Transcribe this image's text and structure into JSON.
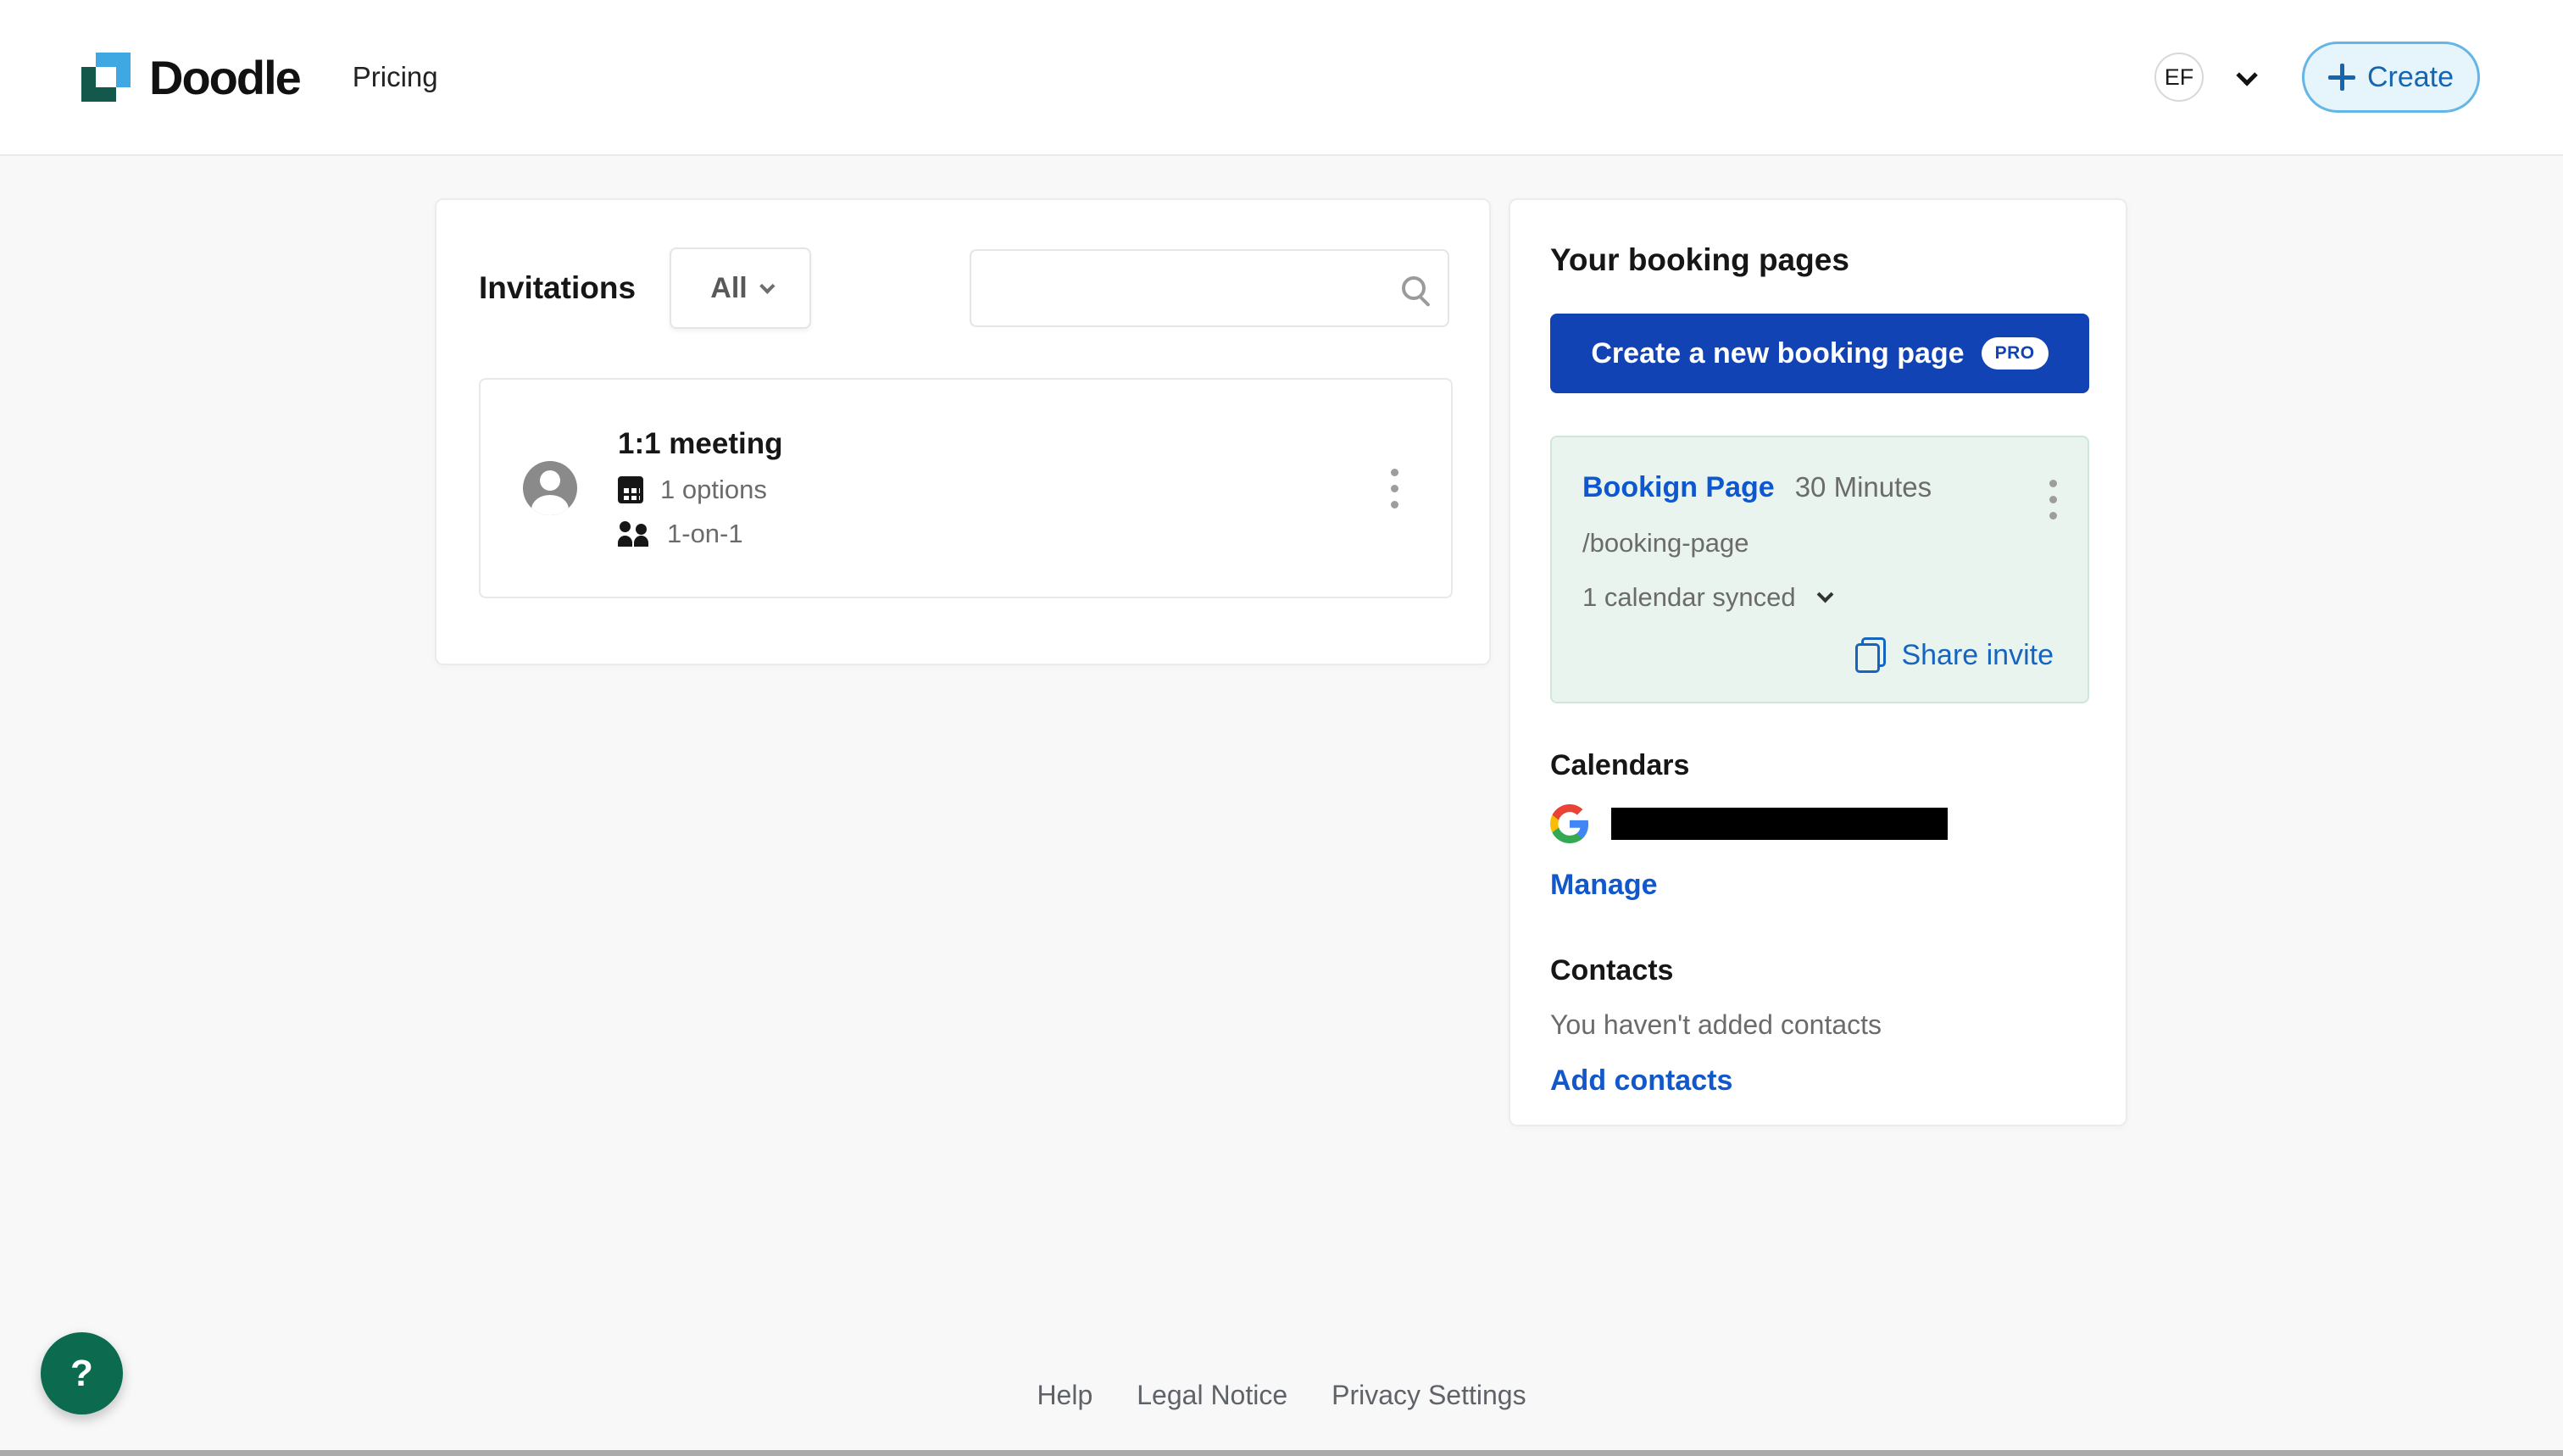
{
  "colors": {
    "primary_button_blue": "#1243B5",
    "link_blue": "#1258CB",
    "booking_name_blue": "#0D57D1",
    "share_link_blue": "#1565C0",
    "booking_card_bg": "#E8F4ED",
    "booking_card_border": "#CFE7D8",
    "create_pill_bg": "#E6F4FC",
    "create_pill_border": "#63B6E6",
    "create_pill_text": "#1566B0",
    "fab_green": "#0C6B4F",
    "logo_blue": "#3FA8E2",
    "logo_green": "#14584C",
    "page_bg": "#F8F8F8"
  },
  "header": {
    "brand": "Doodle",
    "nav_pricing": "Pricing",
    "avatar_initials": "EF",
    "create_label": "Create"
  },
  "invitations": {
    "title": "Invitations",
    "filter_value": "All",
    "search_placeholder": "",
    "items": [
      {
        "title": "1:1 meeting",
        "options": "1 options",
        "participants": "1-on-1"
      }
    ]
  },
  "booking_pages": {
    "title": "Your booking pages",
    "create_label": "Create a new booking page",
    "create_badge": "PRO",
    "page": {
      "name": "Bookign Page",
      "duration": "30 Minutes",
      "slug": "/booking-page",
      "calendar_status": "1 calendar synced",
      "share_label": "Share invite"
    }
  },
  "calendars": {
    "title": "Calendars",
    "provider": "google",
    "account_redacted": true,
    "manage_label": "Manage"
  },
  "contacts": {
    "title": "Contacts",
    "empty_text": "You haven't added contacts",
    "add_label": "Add contacts"
  },
  "footer": {
    "links": [
      "Help",
      "Legal Notice",
      "Privacy Settings"
    ]
  },
  "help_fab": {
    "label": "?"
  }
}
